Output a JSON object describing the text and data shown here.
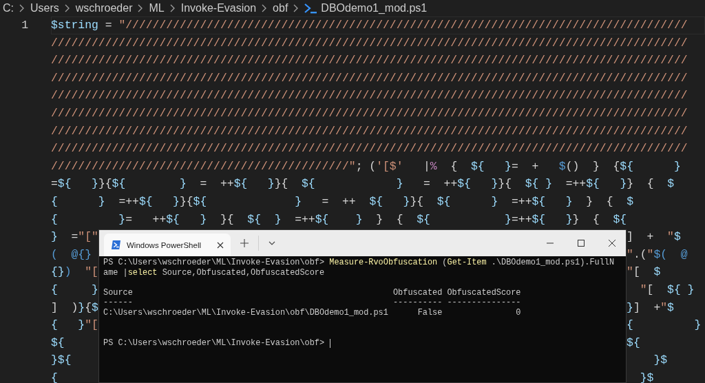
{
  "breadcrumb": [
    {
      "label": "C:",
      "kind": "folder"
    },
    {
      "label": "Users",
      "kind": "folder"
    },
    {
      "label": "wschroeder",
      "kind": "folder"
    },
    {
      "label": "ML",
      "kind": "folder"
    },
    {
      "label": "Invoke-Evasion",
      "kind": "folder"
    },
    {
      "label": "obf",
      "kind": "folder"
    },
    {
      "label": "DBOdemo1_mod.ps1",
      "kind": "file"
    }
  ],
  "editor": {
    "lines": [
      {
        "number": "1",
        "left": [
          {
            "text": "$string",
            "kind": "var"
          },
          {
            "text": " = ",
            "kind": "plain"
          },
          {
            "text": "\"///////////////////////////////////////////////////////////////////////////////////",
            "kind": "string"
          }
        ]
      },
      {
        "left": [
          {
            "text": "//////////////////////////////////////////////////////////////////////////////////////////////",
            "kind": "string"
          }
        ]
      },
      {
        "left": [
          {
            "text": "//////////////////////////////////////////////////////////////////////////////////////////////",
            "kind": "string"
          }
        ]
      },
      {
        "left": [
          {
            "text": "//////////////////////////////////////////////////////////////////////////////////////////////",
            "kind": "string"
          }
        ]
      },
      {
        "left": [
          {
            "text": "//////////////////////////////////////////////////////////////////////////////////////////////",
            "kind": "string"
          }
        ]
      },
      {
        "left": [
          {
            "text": "//////////////////////////////////////////////////////////////////////////////////////////////",
            "kind": "string"
          }
        ]
      },
      {
        "left": [
          {
            "text": "//////////////////////////////////////////////////////////////////////////////////////////////",
            "kind": "string"
          }
        ]
      },
      {
        "left": [
          {
            "text": "//////////////////////////////////////////////////////////////////////////////////////////////",
            "kind": "string"
          }
        ]
      },
      {
        "left": [
          {
            "text": "////////////////////////////////////////////\"",
            "kind": "string"
          },
          {
            "text": "; (",
            "kind": "plain"
          },
          {
            "text": "'[$'",
            "kind": "string"
          },
          {
            "text": "   |",
            "kind": "plain"
          },
          {
            "text": "%",
            "kind": "keyword"
          },
          {
            "text": "  {  ",
            "kind": "plain"
          },
          {
            "text": "${   }",
            "kind": "var"
          },
          {
            "text": "=  +   ",
            "kind": "plain"
          },
          {
            "text": "$",
            "kind": "func"
          },
          {
            "text": "()  }  {",
            "kind": "plain"
          },
          {
            "text": "${      }",
            "kind": "var"
          }
        ]
      },
      {
        "left": [
          {
            "text": "=",
            "kind": "plain"
          },
          {
            "text": "${   }",
            "kind": "var"
          },
          {
            "text": "}{",
            "kind": "plain"
          },
          {
            "text": "${        }",
            "kind": "var"
          },
          {
            "text": "  =  ++",
            "kind": "plain"
          },
          {
            "text": "${   }",
            "kind": "var"
          },
          {
            "text": "}{  ",
            "kind": "plain"
          },
          {
            "text": "${            }",
            "kind": "var"
          },
          {
            "text": "   =  ++",
            "kind": "plain"
          },
          {
            "text": "${   }",
            "kind": "var"
          },
          {
            "text": "}{  ",
            "kind": "plain"
          },
          {
            "text": "${ }",
            "kind": "var"
          },
          {
            "text": "  =++",
            "kind": "plain"
          },
          {
            "text": "${   }",
            "kind": "var"
          },
          {
            "text": "}  {  ",
            "kind": "plain"
          },
          {
            "text": "$",
            "kind": "var"
          }
        ]
      },
      {
        "left": [
          {
            "text": "{      }",
            "kind": "var"
          },
          {
            "text": "  =++",
            "kind": "plain"
          },
          {
            "text": "${   }",
            "kind": "var"
          },
          {
            "text": "}{",
            "kind": "plain"
          },
          {
            "text": "${             }",
            "kind": "var"
          },
          {
            "text": "   =  ++  ",
            "kind": "plain"
          },
          {
            "text": "${   }",
            "kind": "var"
          },
          {
            "text": "}{  ",
            "kind": "plain"
          },
          {
            "text": "${      }",
            "kind": "var"
          },
          {
            "text": "  =++",
            "kind": "plain"
          },
          {
            "text": "${   }",
            "kind": "var"
          },
          {
            "text": "  }  {  ",
            "kind": "plain"
          },
          {
            "text": "$",
            "kind": "var"
          }
        ]
      },
      {
        "left": [
          {
            "text": "{         }",
            "kind": "var"
          },
          {
            "text": "=   ++",
            "kind": "plain"
          },
          {
            "text": "${   }",
            "kind": "var"
          },
          {
            "text": "  }{  ",
            "kind": "plain"
          },
          {
            "text": "${  }",
            "kind": "var"
          },
          {
            "text": "  =++",
            "kind": "plain"
          },
          {
            "text": "${    }",
            "kind": "var"
          },
          {
            "text": "  }  {  ",
            "kind": "plain"
          },
          {
            "text": "${           }",
            "kind": "var"
          },
          {
            "text": "=++",
            "kind": "plain"
          },
          {
            "text": "${   }",
            "kind": "var"
          },
          {
            "text": "}  {  ",
            "kind": "plain"
          },
          {
            "text": "${",
            "kind": "var"
          }
        ]
      },
      {
        "left": [
          {
            "text": "}",
            "kind": "var"
          },
          {
            "text": "  =",
            "kind": "plain"
          },
          {
            "text": "\"[\"",
            "kind": "string"
          }
        ],
        "right": [
          {
            "text": "]  +  ",
            "kind": "plain"
          },
          {
            "text": "\"",
            "kind": "string"
          },
          {
            "text": "$",
            "kind": "var"
          }
        ]
      },
      {
        "left": [
          {
            "text": "(  @{}",
            "kind": "func"
          }
        ],
        "right": [
          {
            "text": "\"",
            "kind": "string"
          },
          {
            "text": ".(",
            "kind": "plain"
          },
          {
            "text": "\"",
            "kind": "string"
          },
          {
            "text": "$(  @",
            "kind": "func"
          }
        ]
      },
      {
        "left": [
          {
            "text": "{}",
            "kind": "var"
          },
          {
            "text": ")  ",
            "kind": "func"
          },
          {
            "text": "\"[",
            "kind": "string"
          }
        ],
        "right": [
          {
            "text": "\"",
            "kind": "string"
          },
          {
            "text": "[  ",
            "kind": "plain"
          },
          {
            "text": "$",
            "kind": "var"
          }
        ]
      },
      {
        "left": [
          {
            "text": "{     }",
            "kind": "var"
          }
        ],
        "right": [
          {
            "text": "  \"",
            "kind": "string"
          },
          {
            "text": "[  ",
            "kind": "plain"
          },
          {
            "text": "${ }",
            "kind": "var"
          }
        ]
      },
      {
        "left": [
          {
            "text": "]  )",
            "kind": "plain"
          },
          {
            "text": "}",
            "kind": "var"
          },
          {
            "text": "{",
            "kind": "plain"
          },
          {
            "text": "$",
            "kind": "var"
          }
        ],
        "right": [
          {
            "text": "}",
            "kind": "var"
          },
          {
            "text": "]  +",
            "kind": "plain"
          },
          {
            "text": "\"",
            "kind": "string"
          },
          {
            "text": "$",
            "kind": "var"
          }
        ]
      },
      {
        "left": [
          {
            "text": "{   }",
            "kind": "var"
          },
          {
            "text": "\"[",
            "kind": "string"
          }
        ],
        "right": [
          {
            "text": "{         }",
            "kind": "var"
          }
        ]
      },
      {
        "left": [
          {
            "text": "${",
            "kind": "var"
          }
        ],
        "right": [
          {
            "text": "${",
            "kind": "var"
          }
        ]
      },
      {
        "left": [
          {
            "text": "}${",
            "kind": "var"
          }
        ],
        "right": [
          {
            "text": "    }$",
            "kind": "var"
          }
        ]
      },
      {
        "left": [
          {
            "text": "{",
            "kind": "var"
          }
        ],
        "right": [
          {
            "text": "  }$",
            "kind": "var"
          }
        ]
      }
    ]
  },
  "terminal": {
    "tab": {
      "title": "Windows PowerShell",
      "selected": true
    },
    "lines": [
      {
        "tokens": [
          {
            "text": "PS C:\\Users\\wschroeder\\ML\\Invoke-Evasion\\obf> ",
            "kind": "plain"
          },
          {
            "text": "Measure-RvoObfuscation",
            "kind": "command"
          },
          {
            "text": " (",
            "kind": "plain"
          },
          {
            "text": "Get-Item",
            "kind": "command"
          },
          {
            "text": " .\\DBOdemo1_mod.ps1).FullN",
            "kind": "plain"
          }
        ]
      },
      {
        "tokens": [
          {
            "text": "ame |",
            "kind": "plain"
          },
          {
            "text": "select",
            "kind": "command"
          },
          {
            "text": " Source,Obfuscated,ObfuscatedScore",
            "kind": "plain"
          }
        ]
      }
    ],
    "table": {
      "columns": [
        "Source",
        "Obfuscated",
        "ObfuscatedScore"
      ],
      "rules": [
        "------",
        "----------",
        "---------------"
      ],
      "rows": [
        [
          "C:\\Users\\wschroeder\\ML\\Invoke-Evasion\\obf\\DBOdemo1_mod.ps1",
          "False",
          "0"
        ]
      ]
    },
    "prompt": "PS C:\\Users\\wschroeder\\ML\\Invoke-Evasion\\obf> "
  }
}
